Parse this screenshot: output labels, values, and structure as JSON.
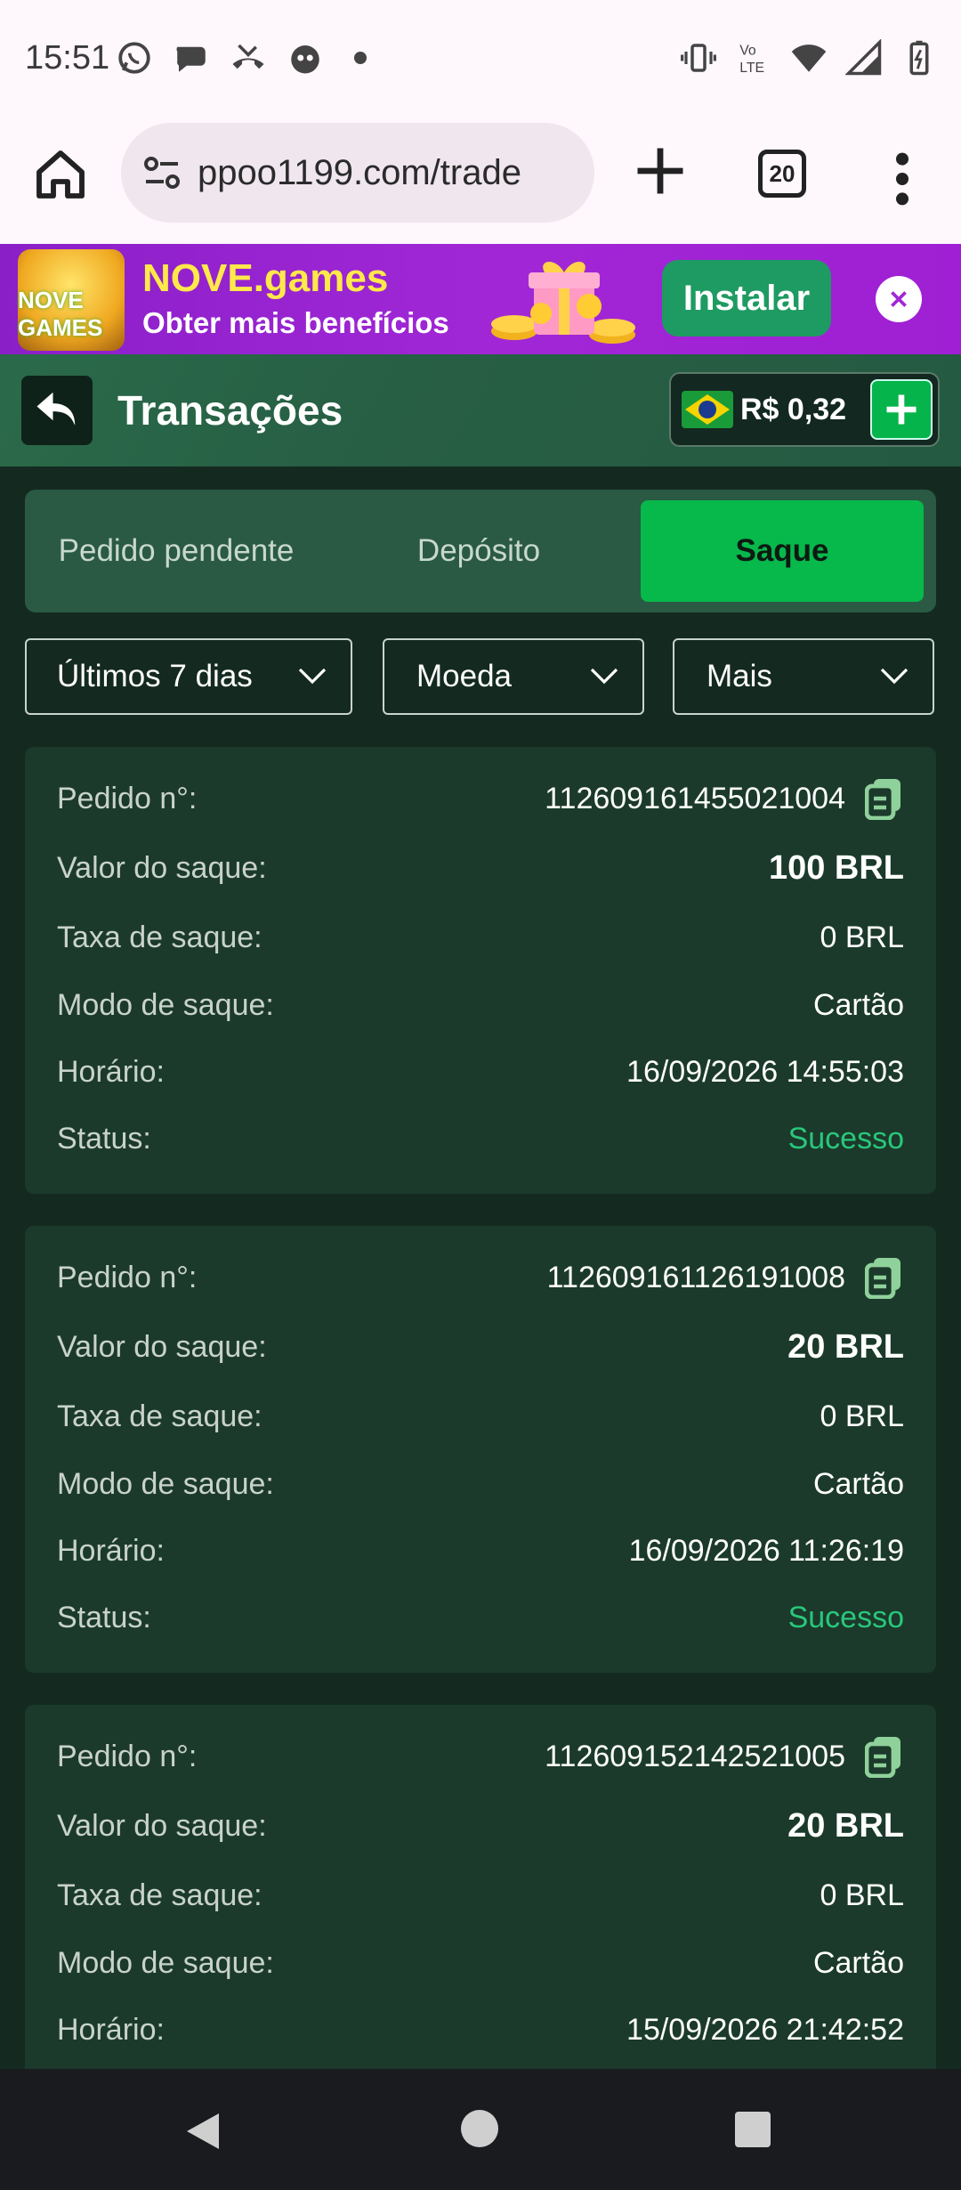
{
  "status_bar": {
    "time": "15:51",
    "icons": [
      "whatsapp-icon",
      "chat-icon",
      "missed-call-icon",
      "app-icon",
      "vibrate-icon",
      "volte-icon",
      "wifi-icon",
      "signal-icon",
      "battery-icon"
    ]
  },
  "browser": {
    "url": "ppoo1199.com/trade",
    "tab_count": "20"
  },
  "banner": {
    "title": "NOVE.games",
    "subtitle": "Obter mais benefícios",
    "install_label": "Instalar",
    "logo_text": "NOVE GAMES"
  },
  "header": {
    "title": "Transações",
    "balance": "R$ 0,32"
  },
  "tabs": [
    {
      "label": "Pedido pendente",
      "active": false
    },
    {
      "label": "Depósito",
      "active": false
    },
    {
      "label": "Saque",
      "active": true
    }
  ],
  "filters": {
    "period": "Últimos 7 dias",
    "currency": "Moeda",
    "more": "Mais"
  },
  "labels": {
    "order": "Pedido n°:",
    "amount": "Valor do saque:",
    "fee": "Taxa de saque:",
    "mode": "Modo de saque:",
    "time": "Horário:",
    "status": "Status:"
  },
  "transactions": [
    {
      "order_no": "112609161455021004",
      "amount": "100 BRL",
      "fee": "0 BRL",
      "mode": "Cartão",
      "time": "16/09/2026 14:55:03",
      "status": "Sucesso"
    },
    {
      "order_no": "112609161126191008",
      "amount": "20 BRL",
      "fee": "0 BRL",
      "mode": "Cartão",
      "time": "16/09/2026 11:26:19",
      "status": "Sucesso"
    },
    {
      "order_no": "112609152142521005",
      "amount": "20 BRL",
      "fee": "0 BRL",
      "mode": "Cartão",
      "time": "15/09/2026 21:42:52",
      "status": ""
    }
  ],
  "colors": {
    "accent": "#07b84b",
    "success": "#29c77b",
    "background": "#142a21",
    "card": "#1b3a2b",
    "banner": "#a127d6"
  }
}
